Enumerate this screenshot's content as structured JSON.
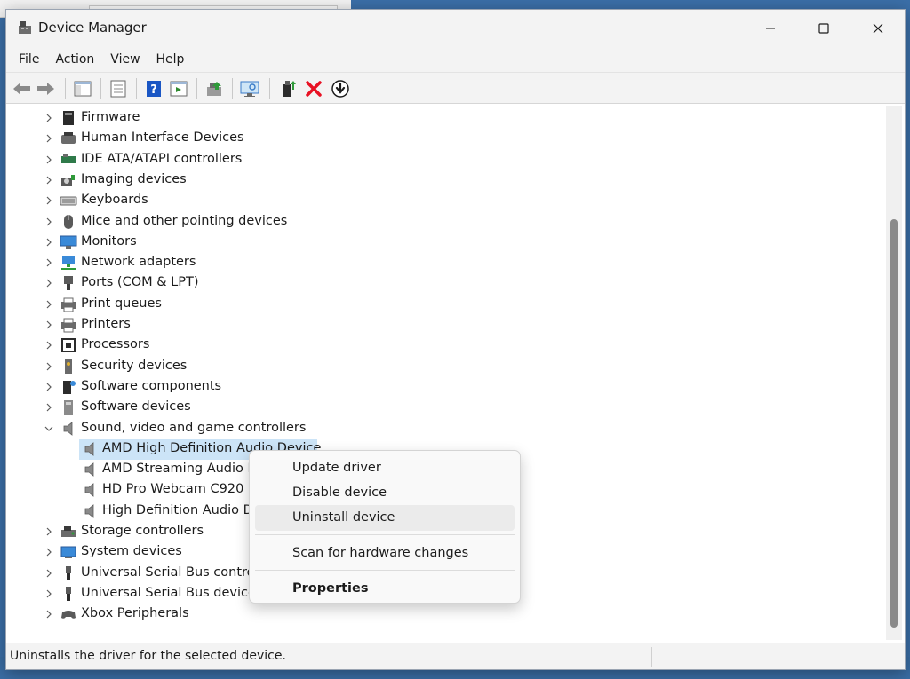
{
  "window": {
    "title": "Device Manager"
  },
  "menu": [
    "File",
    "Action",
    "View",
    "Help"
  ],
  "toolbar": {
    "icons": [
      "back-arrow-icon",
      "forward-arrow-icon",
      "show-hide-console-tree-icon",
      "properties-icon",
      "help-icon",
      "action-pane-icon",
      "update-driver-icon",
      "scan-hardware-icon",
      "enable-device-icon",
      "uninstall-device-icon",
      "disable-device-icon"
    ]
  },
  "tree": {
    "categories": [
      {
        "label": "Firmware",
        "icon": "firmware-icon",
        "expanded": false
      },
      {
        "label": "Human Interface Devices",
        "icon": "hid-icon",
        "expanded": false
      },
      {
        "label": "IDE ATA/ATAPI controllers",
        "icon": "ide-controller-icon",
        "expanded": false
      },
      {
        "label": "Imaging devices",
        "icon": "camera-icon",
        "expanded": false
      },
      {
        "label": "Keyboards",
        "icon": "keyboard-icon",
        "expanded": false
      },
      {
        "label": "Mice and other pointing devices",
        "icon": "mouse-icon",
        "expanded": false
      },
      {
        "label": "Monitors",
        "icon": "monitor-icon",
        "expanded": false
      },
      {
        "label": "Network adapters",
        "icon": "network-icon",
        "expanded": false
      },
      {
        "label": "Ports (COM & LPT)",
        "icon": "port-icon",
        "expanded": false
      },
      {
        "label": "Print queues",
        "icon": "printer-icon",
        "expanded": false
      },
      {
        "label": "Printers",
        "icon": "printer-icon",
        "expanded": false
      },
      {
        "label": "Processors",
        "icon": "processor-icon",
        "expanded": false
      },
      {
        "label": "Security devices",
        "icon": "security-key-icon",
        "expanded": false
      },
      {
        "label": "Software components",
        "icon": "software-component-icon",
        "expanded": false
      },
      {
        "label": "Software devices",
        "icon": "software-device-icon",
        "expanded": false
      },
      {
        "label": "Sound, video and game controllers",
        "icon": "speaker-icon",
        "expanded": true
      }
    ],
    "sound_children": [
      {
        "label": "AMD High Definition Audio Device",
        "icon": "speaker-icon",
        "selected": true
      },
      {
        "label": "AMD Streaming Audio Device",
        "icon": "speaker-icon",
        "selected": false
      },
      {
        "label": "HD Pro Webcam C920",
        "icon": "speaker-icon",
        "selected": false
      },
      {
        "label": "High Definition Audio Device",
        "icon": "speaker-icon",
        "selected": false
      }
    ],
    "after": [
      {
        "label": "Storage controllers",
        "icon": "storage-icon",
        "expanded": false
      },
      {
        "label": "System devices",
        "icon": "system-icon",
        "expanded": false
      },
      {
        "label": "Universal Serial Bus controllers",
        "icon": "usb-icon",
        "expanded": false
      },
      {
        "label": "Universal Serial Bus devices",
        "icon": "usb-icon",
        "expanded": false
      },
      {
        "label": "Xbox Peripherals",
        "icon": "gamepad-icon",
        "expanded": false
      }
    ]
  },
  "context_menu": {
    "items": [
      {
        "label": "Update driver",
        "bold": false,
        "hover": false
      },
      {
        "label": "Disable device",
        "bold": false,
        "hover": false
      },
      {
        "label": "Uninstall device",
        "bold": false,
        "hover": true
      },
      {
        "label": "Scan for hardware changes",
        "bold": false,
        "hover": false
      },
      {
        "label": "Properties",
        "bold": true,
        "hover": false
      }
    ]
  },
  "status": {
    "text": "Uninstalls the driver for the selected device."
  },
  "colors": {
    "selection": "#cce4f7",
    "hover": "#ebebeb",
    "uninstall_red": "#e81123",
    "help_blue": "#1a56c4"
  }
}
